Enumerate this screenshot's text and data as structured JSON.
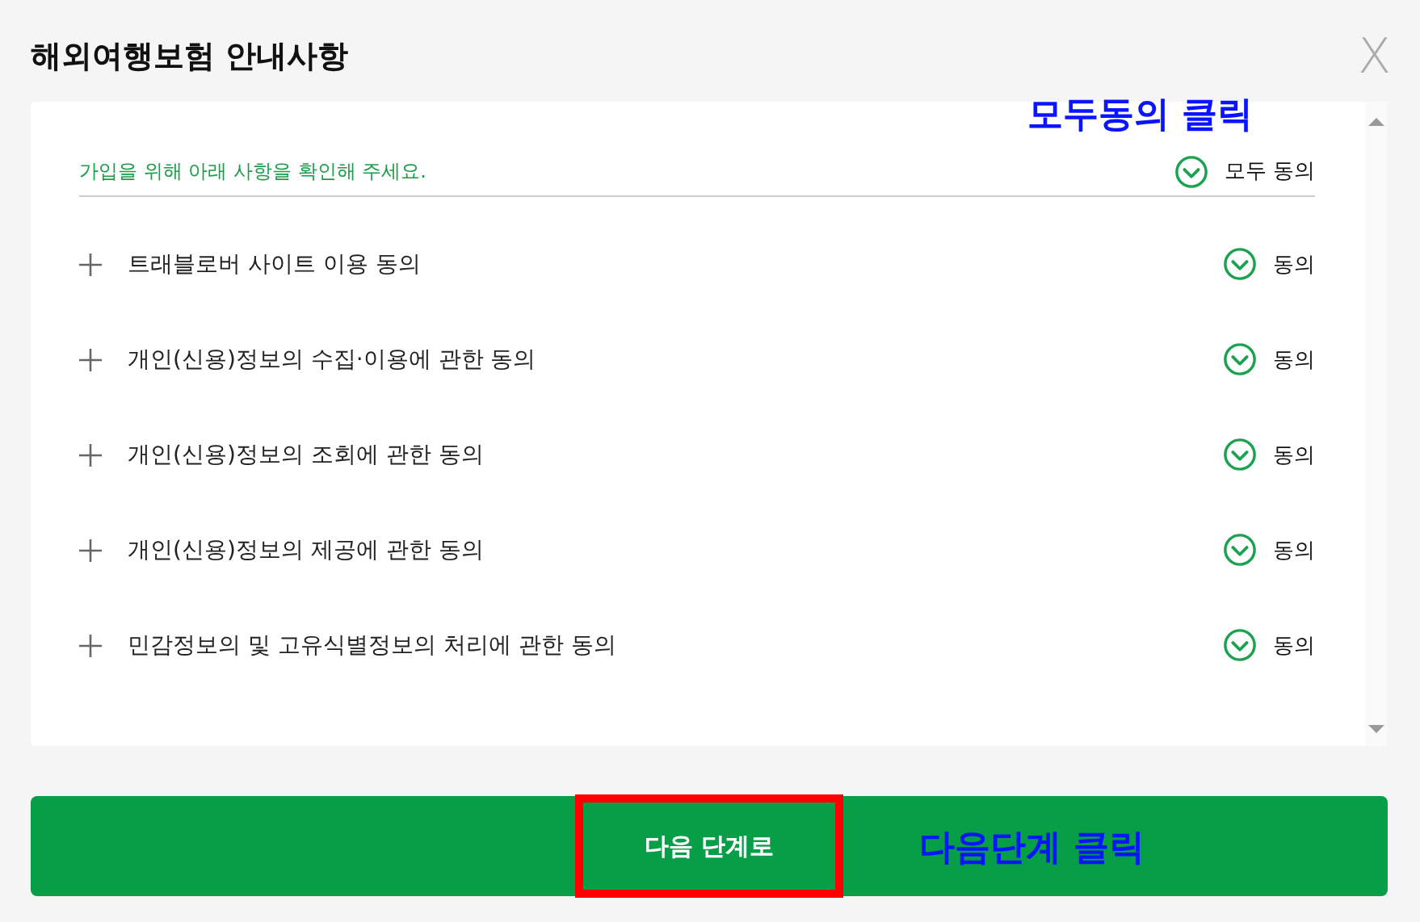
{
  "dialog": {
    "title": "해외여행보험 안내사항",
    "close": "X"
  },
  "header": {
    "instruction": "가입을 위해 아래 사항을 확인해 주세요.",
    "agree_all": {
      "label": "모두 동의",
      "checked": true
    }
  },
  "items": [
    {
      "label": "트래블로버 사이트 이용 동의",
      "expanded": false,
      "agree": {
        "label": "동의",
        "checked": true
      }
    },
    {
      "label": "개인(신용)정보의 수집·이용에 관한 동의",
      "expanded": false,
      "agree": {
        "label": "동의",
        "checked": true
      }
    },
    {
      "label": "개인(신용)정보의 조회에 관한 동의",
      "expanded": false,
      "agree": {
        "label": "동의",
        "checked": true
      }
    },
    {
      "label": "개인(신용)정보의 제공에 관한 동의",
      "expanded": false,
      "agree": {
        "label": "동의",
        "checked": true
      }
    },
    {
      "label": "민감정보의 및 고유식별정보의 처리에 관한 동의",
      "expanded": false,
      "agree": {
        "label": "동의",
        "checked": true
      }
    }
  ],
  "next_button": {
    "label": "다음 단계로",
    "highlighted": true
  },
  "annotations": [
    {
      "kind": "top",
      "text": "모두동의 클릭"
    },
    {
      "kind": "bottom",
      "text": "다음단계 클릭"
    }
  ]
}
